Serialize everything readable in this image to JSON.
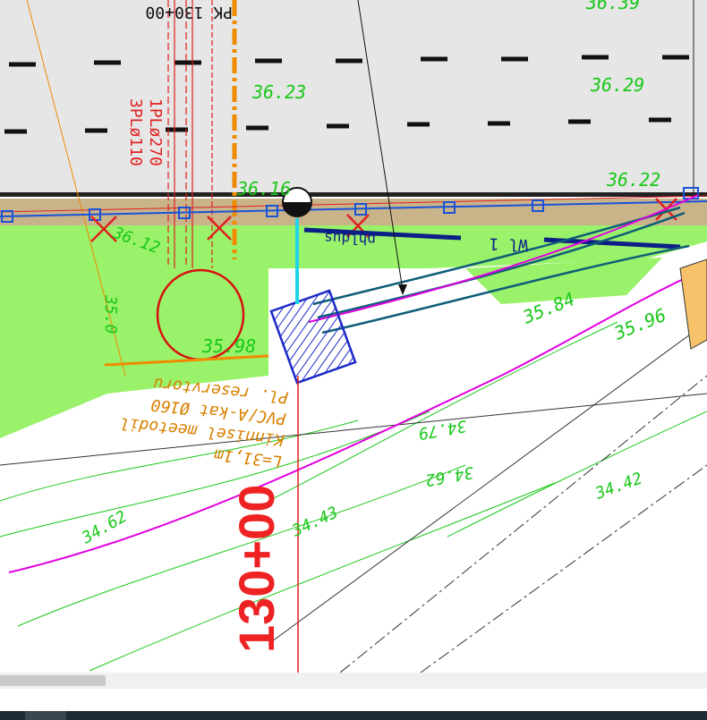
{
  "station_label": "130+00",
  "station_label_mirrored": "PK 130+00",
  "elevations": {
    "e1": "36.39",
    "e2": "36.23",
    "e3": "36.29",
    "e4": "36.16",
    "e5": "36.22",
    "e6": "35.98",
    "e7": "35.84",
    "e8": "35.96",
    "e9": "34.79",
    "e10": "34.62",
    "e11": "34.42",
    "e12": "34.43",
    "e13": "34.62",
    "e14": "35.0",
    "e15": "36.12"
  },
  "pipe_labels": {
    "p1": "1PLø270",
    "p2": "3PLø110"
  },
  "annotation_lines": {
    "l1": "L=31,1m",
    "l2": "Kinnisel meetodil",
    "l3": "PVC/A-kat Ø160",
    "l4": "Pl. reservtoru"
  },
  "utility_labels": {
    "u1": "Wl 1",
    "u2": "phldus"
  },
  "colors": {
    "road": "#e6e6e6",
    "grass": "#99f26a",
    "annotation_green": "#18c818",
    "pipe_red": "#e02020",
    "water_blue": "#1a52d8",
    "magenta": "#e000e0",
    "orange": "#f08a00",
    "teal": "#0f5e78"
  },
  "scroll": {
    "position": 0.15
  }
}
